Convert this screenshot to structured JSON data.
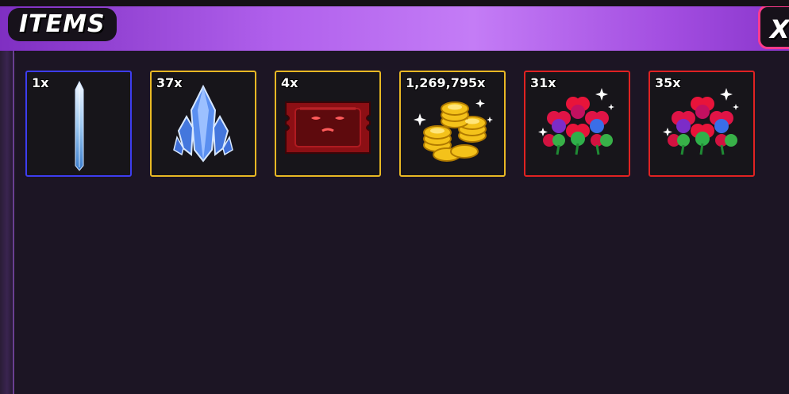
{
  "header": {
    "title": "ITEMS",
    "close_label": "X"
  },
  "colors": {
    "header_gradient_start": "#7f2fc2",
    "header_gradient_mid": "#c47cf6",
    "panel_bg": "#1c1524",
    "slot_bg": "#17151a",
    "rarity_common": "#3d3df0",
    "rarity_rare": "#e8b824",
    "rarity_epic": "#e02222",
    "close_border": "#ff3b8c"
  },
  "items": [
    {
      "count": "1x",
      "name_icon": "sword-icon",
      "rarity": "common"
    },
    {
      "count": "37x",
      "name_icon": "crystal-icon",
      "rarity": "rare"
    },
    {
      "count": "4x",
      "name_icon": "ticket-icon",
      "rarity": "rare"
    },
    {
      "count": "1,269,795x",
      "name_icon": "coins-icon",
      "rarity": "rare"
    },
    {
      "count": "31x",
      "name_icon": "clover-icon",
      "rarity": "epic"
    },
    {
      "count": "35x",
      "name_icon": "clover-icon",
      "rarity": "epic"
    }
  ]
}
